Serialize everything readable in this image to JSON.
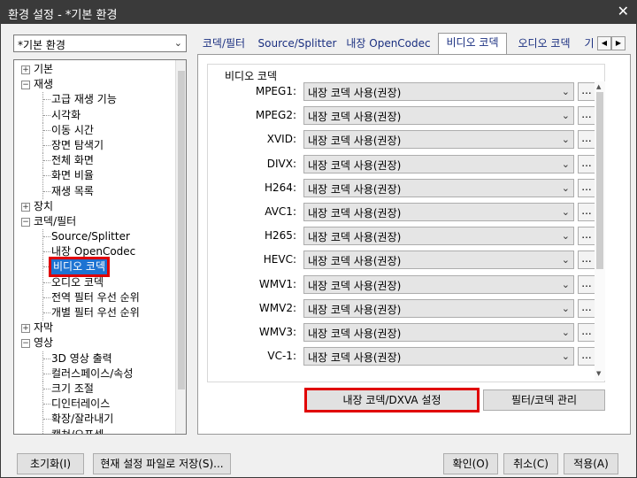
{
  "window": {
    "title": "환경 설정 - *기본 환경",
    "close_glyph": "✕"
  },
  "preset": {
    "value": "*기본 환경"
  },
  "tree": [
    {
      "label": "기본",
      "level": 0,
      "expander": "+"
    },
    {
      "label": "재생",
      "level": 0,
      "expander": "−"
    },
    {
      "label": "고급 재생 기능",
      "level": 1
    },
    {
      "label": "시각화",
      "level": 1
    },
    {
      "label": "이동 시간",
      "level": 1
    },
    {
      "label": "장면 탐색기",
      "level": 1
    },
    {
      "label": "전체 화면",
      "level": 1
    },
    {
      "label": "화면 비율",
      "level": 1
    },
    {
      "label": "재생 목록",
      "level": 1
    },
    {
      "label": "장치",
      "level": 0,
      "expander": "+"
    },
    {
      "label": "코덱/필터",
      "level": 0,
      "expander": "−"
    },
    {
      "label": "Source/Splitter",
      "level": 1
    },
    {
      "label": "내장 OpenCodec",
      "level": 1
    },
    {
      "label": "비디오 코덱",
      "level": 1,
      "selected": true
    },
    {
      "label": "오디오 코덱",
      "level": 1
    },
    {
      "label": "전역 필터 우선 순위",
      "level": 1
    },
    {
      "label": "개별 필터 우선 순위",
      "level": 1
    },
    {
      "label": "자막",
      "level": 0,
      "expander": "+"
    },
    {
      "label": "영상",
      "level": 0,
      "expander": "−"
    },
    {
      "label": "3D 영상 출력",
      "level": 1
    },
    {
      "label": "컬러스페이스/속성",
      "level": 1
    },
    {
      "label": "크기 조절",
      "level": 1
    },
    {
      "label": "디인터레이스",
      "level": 1
    },
    {
      "label": "확장/잘라내기",
      "level": 1
    },
    {
      "label": "캡쳐/으프셋",
      "level": 1
    }
  ],
  "tabs": [
    "코덱/필터",
    "Source/Splitter",
    "내장 OpenCodec",
    "비디오 코덱",
    "오디오 코덱",
    "기"
  ],
  "active_tab": 3,
  "tab_scroll": {
    "left": "◀",
    "right": "▶"
  },
  "video_codecs": {
    "group_title": "비디오 코덱",
    "more_label": "...",
    "rows": [
      {
        "name": "MPEG1:",
        "value": "내장 코덱 사용(권장)"
      },
      {
        "name": "MPEG2:",
        "value": "내장 코덱 사용(권장)"
      },
      {
        "name": "XVID:",
        "value": "내장 코덱 사용(권장)"
      },
      {
        "name": "DIVX:",
        "value": "내장 코덱 사용(권장)"
      },
      {
        "name": "H264:",
        "value": "내장 코덱 사용(권장)"
      },
      {
        "name": "AVC1:",
        "value": "내장 코덱 사용(권장)"
      },
      {
        "name": "H265:",
        "value": "내장 코덱 사용(권장)"
      },
      {
        "name": "HEVC:",
        "value": "내장 코덱 사용(권장)"
      },
      {
        "name": "WMV1:",
        "value": "내장 코덱 사용(권장)"
      },
      {
        "name": "WMV2:",
        "value": "내장 코덱 사용(권장)"
      },
      {
        "name": "WMV3:",
        "value": "내장 코덱 사용(권장)"
      },
      {
        "name": "VC-1:",
        "value": "내장 코덱 사용(권장)"
      }
    ]
  },
  "panel_buttons": {
    "builtin_dxva": "내장 코덱/DXVA 설정",
    "filter_manage": "필터/코덱 관리"
  },
  "bottom_buttons": {
    "reset": "초기화(I)",
    "save_current": "현재 설정 파일로 저장(S)...",
    "ok": "확인(O)",
    "cancel": "취소(C)",
    "apply": "적용(A)"
  },
  "colors": {
    "highlight_red": "#e00000",
    "selection_blue": "#1e73d2"
  }
}
